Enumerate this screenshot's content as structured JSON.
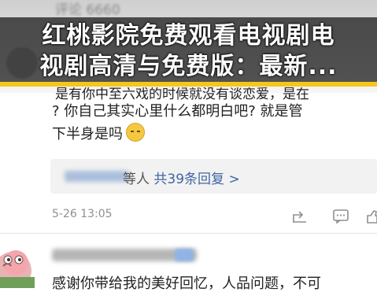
{
  "title_banner": {
    "line1": "红桃影院免费观看电视剧电",
    "line2": "视剧高清与免费版：最新..."
  },
  "top_comment": {
    "partial_line": "是有你中至六戏的时候就没有谈恋爱，是在",
    "line1": "是有你中至六戏的时候就没有谈恋爱，是在",
    "line2": "? 你自己其实心里什么都明白吧? 就是管",
    "line3": "下半身是吗",
    "emoji": "sleepy-emoji"
  },
  "reply_summary": {
    "lead": "等人",
    "count_text": "共39条回复",
    "chevron": ">"
  },
  "meta": {
    "timestamp": "5-26 13:05",
    "header_partial": "评论 6660"
  },
  "actions": {
    "share_icon": "share-icon",
    "comment_icon": "comment-icon",
    "like_icon": "like-icon"
  },
  "second_comment": {
    "text": "感谢你带给我的美好回忆，人品问题，不可"
  },
  "colors": {
    "banner_bg": "#141414",
    "accent_bar": "#f7c51c",
    "link_blue": "#3f66a5",
    "meta_gray": "#8f8f8f"
  }
}
